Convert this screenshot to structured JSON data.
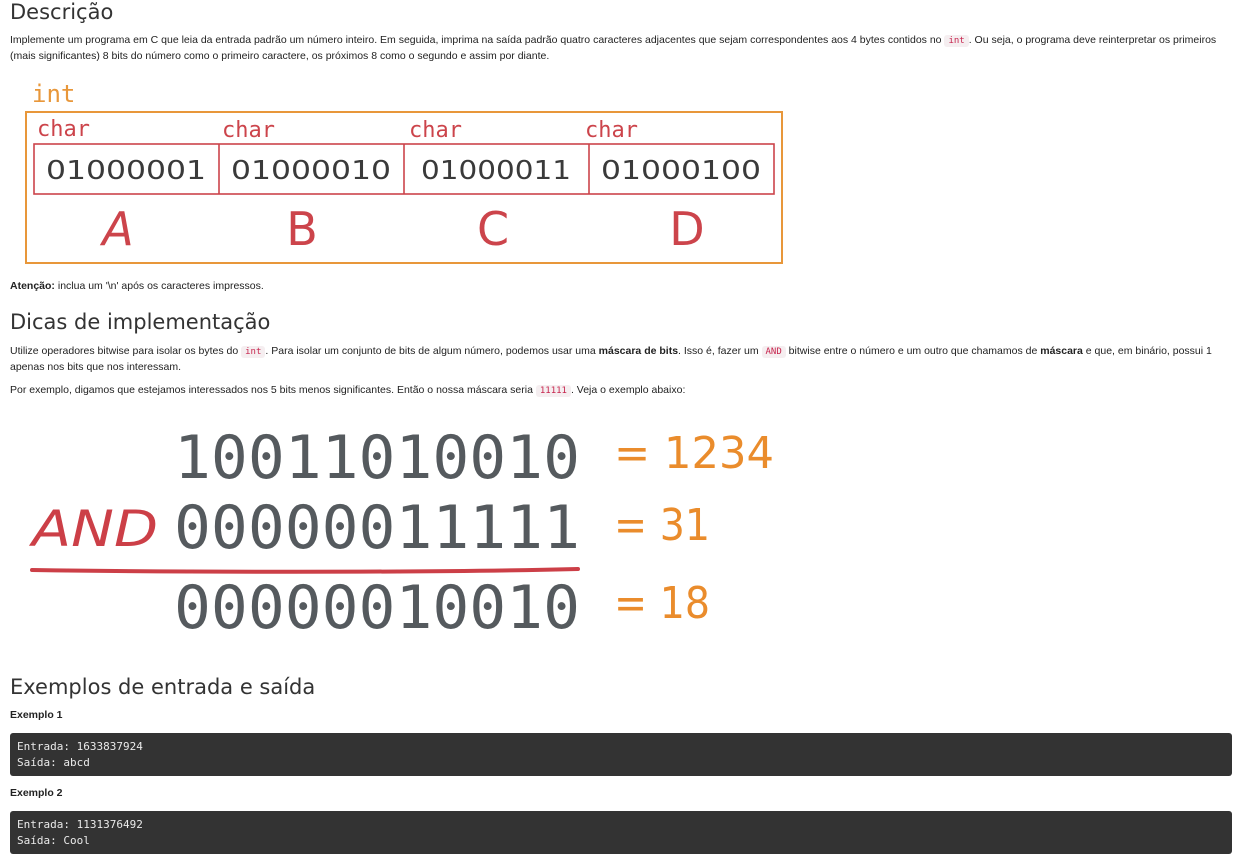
{
  "descricao": {
    "title": "Descrição",
    "p1_a": "Implemente um programa em C que leia da entrada padrão um número inteiro. Em seguida, imprima na saída padrão quatro caracteres adjacentes que sejam correspondentes aos 4 bytes contidos no ",
    "p1_code": "int",
    "p1_b": ". Ou seja, o programa deve reinterpretar os primeiros (mais significantes) 8 bits do número como o primeiro caractere, os próximos 8 como o segundo e assim por diante.",
    "atencao_label": "Atenção:",
    "atencao_text": " inclua um '\\n' após os caracteres impressos."
  },
  "bytes_figure": {
    "int_label": "int",
    "char_label": "char",
    "bytes": [
      "01000001",
      "01000010",
      "01000011",
      "01000100"
    ],
    "letters": [
      "A",
      "B",
      "C",
      "D"
    ],
    "colors": {
      "orange": "#e8973a",
      "red": "#cc444b",
      "ink": "#3a3a3a"
    }
  },
  "dicas": {
    "title": "Dicas de implementação",
    "p1_a": "Utilize operadores bitwise para isolar os bytes do ",
    "p1_code1": "int",
    "p1_b": ". Para isolar um conjunto de bits de algum número, podemos usar uma ",
    "p1_bold1": "máscara de bits",
    "p1_c": ". Isso é, fazer um ",
    "p1_code2": "AND",
    "p1_d": " bitwise entre o número e um outro que chamamos de ",
    "p1_bold2": "máscara",
    "p1_e": " e que, em binário, possui 1 apenas nos bits que nos interessam.",
    "p2_a": "Por exemplo, digamos que estejamos interessados nos 5 bits menos significantes. Então o nossa máscara seria ",
    "p2_code": "11111",
    "p2_b": ". Veja o exemplo abaixo:"
  },
  "and_figure": {
    "row1": "10011010010",
    "row2": "00000011111",
    "row3": "00000010010",
    "op": "AND",
    "eq1": "= 1234",
    "eq2": "= 31",
    "eq3": "= 18",
    "colors": {
      "digits": "#555a5e",
      "red": "#cc3f47",
      "orange": "#ea8c2c"
    }
  },
  "exemplos": {
    "title": "Exemplos de entrada e saída",
    "items": [
      {
        "label": "Exemplo 1",
        "line1": "Entrada: 1633837924",
        "line2": "Saída: abcd"
      },
      {
        "label": "Exemplo 2",
        "line1": "Entrada: 1131376492",
        "line2": "Saída: Cool"
      }
    ]
  }
}
